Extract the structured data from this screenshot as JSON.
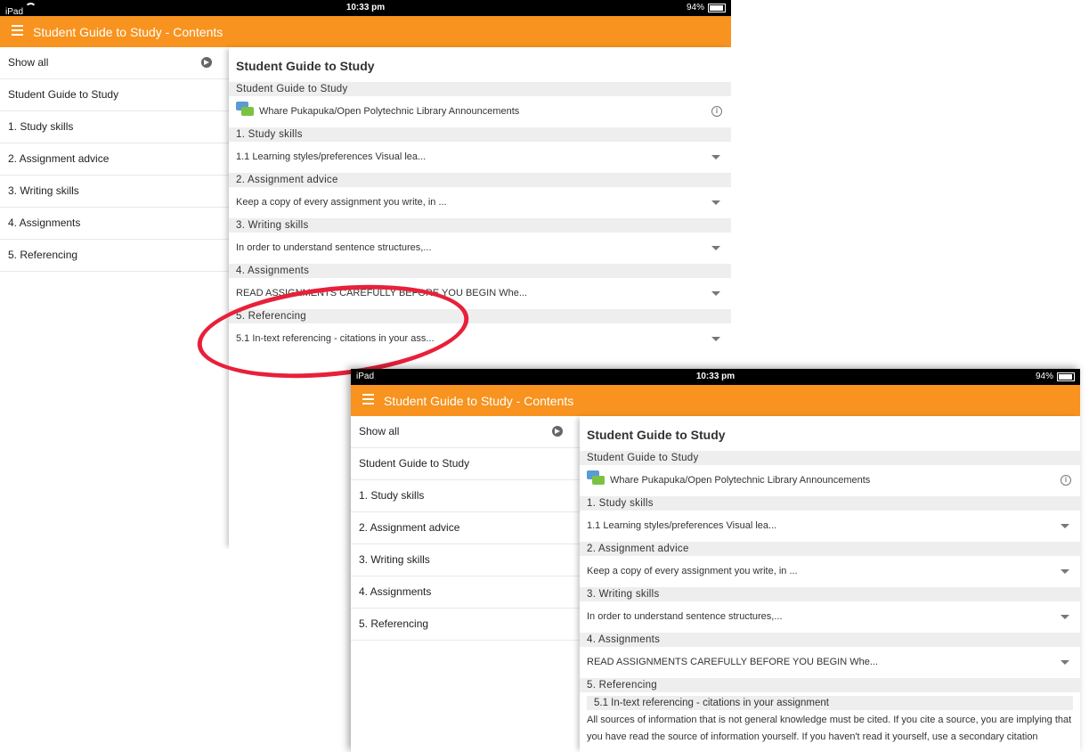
{
  "status": {
    "device": "iPad",
    "time": "10:33 pm",
    "battery": "94%"
  },
  "appbar": {
    "title": "Student Guide to Study - Contents"
  },
  "sidebar": {
    "items": [
      {
        "label": "Show all"
      },
      {
        "label": "Student Guide to Study"
      },
      {
        "label": "1. Study skills"
      },
      {
        "label": "2. Assignment advice"
      },
      {
        "label": "3. Writing skills"
      },
      {
        "label": "4. Assignments"
      },
      {
        "label": "5. Referencing"
      }
    ]
  },
  "content": {
    "title": "Student Guide to Study",
    "sections": [
      {
        "header": "Student Guide to Study",
        "item": "Whare Pukapuka/Open Polytechnic Library Announcements"
      },
      {
        "header": "1. Study skills",
        "item": "1.1 Learning styles/preferences Visual lea..."
      },
      {
        "header": "2. Assignment advice",
        "item": "Keep a copy of every assignment you write, in ..."
      },
      {
        "header": "3. Writing skills",
        "item": "In order to understand sentence structures,..."
      },
      {
        "header": "4. Assignments",
        "item": "READ ASSIGNMENTS CAREFULLY BEFORE YOU BEGIN Whe..."
      },
      {
        "header": "5. Referencing",
        "item": "5.1 In-text referencing - citations in your ass..."
      }
    ],
    "expanded": {
      "title": "5.1 In-text referencing - citations in your assignment",
      "body": "All sources of information that is not general knowledge must be cited. If you cite a source, you are implying that you have read the source of information yourself. If you haven't read it yourself, use a secondary citation"
    }
  },
  "colors": {
    "accent": "#f7931e",
    "highlight": "#e8203a"
  }
}
